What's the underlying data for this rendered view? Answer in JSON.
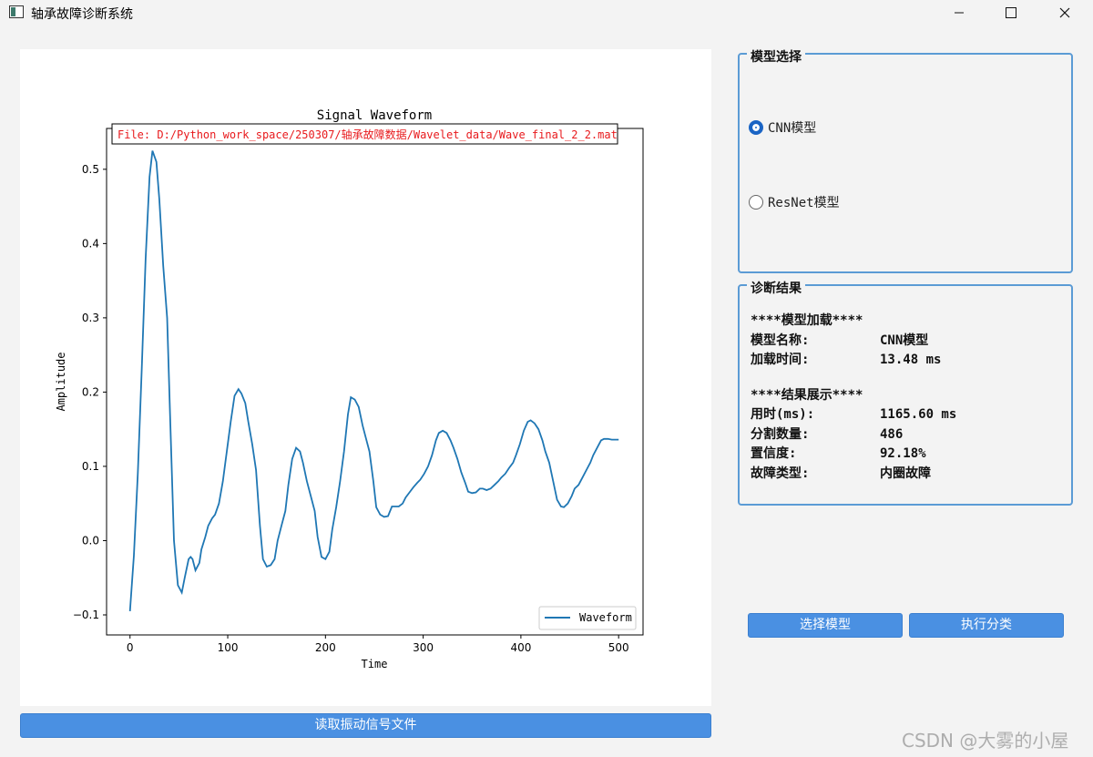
{
  "window": {
    "title": "轴承故障诊断系统",
    "icons": [
      "app-icon",
      "minimize-icon",
      "maximize-icon",
      "close-icon"
    ]
  },
  "plot": {
    "file_label": "File: D:/Python_work_space/250307/轴承故障数据/Wavelet_data/Wave_final_2_2.mat",
    "file_label_color": "#e8191c",
    "line_color": "#1f77b4"
  },
  "chart_data": {
    "type": "line",
    "title": "Signal Waveform",
    "xlabel": "Time",
    "ylabel": "Amplitude",
    "xlim": [
      -24,
      525
    ],
    "ylim": [
      -0.127,
      0.555
    ],
    "xticks": [
      0,
      100,
      200,
      300,
      400,
      500
    ],
    "yticks": [
      -0.1,
      0.0,
      0.1,
      0.2,
      0.3,
      0.4,
      0.5
    ],
    "xtick_labels": [
      "0",
      "100",
      "200",
      "300",
      "400",
      "500"
    ],
    "ytick_labels": [
      "−0.1",
      "0.0",
      "0.1",
      "0.2",
      "0.3",
      "0.4",
      "0.5"
    ],
    "legend": "bottom-right",
    "grid": false,
    "series": [
      {
        "name": "Waveform",
        "x": [
          0,
          4,
          8,
          12,
          16,
          20,
          23,
          27,
          30,
          34,
          38,
          41,
          45,
          49,
          53,
          56,
          60,
          62,
          64,
          67,
          71,
          73,
          77,
          80,
          84,
          87,
          91,
          95,
          99,
          103,
          107,
          111,
          114,
          118,
          121,
          125,
          129,
          133,
          136,
          140,
          144,
          148,
          151,
          155,
          159,
          162,
          166,
          170,
          174,
          177,
          181,
          185,
          189,
          192,
          196,
          200,
          204,
          207,
          211,
          215,
          219,
          223,
          226,
          230,
          234,
          238,
          241,
          245,
          249,
          252,
          256,
          260,
          264,
          268,
          271,
          275,
          279,
          282,
          286,
          290,
          294,
          297,
          301,
          305,
          309,
          313,
          316,
          320,
          324,
          328,
          331,
          335,
          339,
          343,
          346,
          350,
          354,
          358,
          361,
          365,
          369,
          373,
          377,
          380,
          384,
          388,
          392,
          395,
          399,
          403,
          407,
          410,
          414,
          418,
          422,
          425,
          429,
          433,
          437,
          441,
          444,
          448,
          452,
          455,
          459,
          463,
          467,
          471,
          474,
          478,
          482,
          485,
          489,
          493,
          497,
          500
        ],
        "y": [
          -0.095,
          -0.02,
          0.09,
          0.23,
          0.38,
          0.49,
          0.525,
          0.51,
          0.46,
          0.37,
          0.3,
          0.17,
          0.0,
          -0.06,
          -0.07,
          -0.05,
          -0.025,
          -0.022,
          -0.025,
          -0.04,
          -0.03,
          -0.012,
          0.005,
          0.02,
          0.03,
          0.035,
          0.05,
          0.08,
          0.12,
          0.16,
          0.195,
          0.204,
          0.198,
          0.185,
          0.16,
          0.13,
          0.095,
          0.02,
          -0.025,
          -0.035,
          -0.033,
          -0.025,
          0.0,
          0.02,
          0.04,
          0.075,
          0.11,
          0.125,
          0.12,
          0.105,
          0.08,
          0.06,
          0.04,
          0.005,
          -0.022,
          -0.025,
          -0.015,
          0.015,
          0.045,
          0.08,
          0.12,
          0.17,
          0.193,
          0.19,
          0.18,
          0.155,
          0.14,
          0.12,
          0.08,
          0.045,
          0.035,
          0.032,
          0.033,
          0.046,
          0.046,
          0.046,
          0.05,
          0.058,
          0.065,
          0.072,
          0.078,
          0.082,
          0.09,
          0.1,
          0.115,
          0.135,
          0.145,
          0.148,
          0.145,
          0.135,
          0.125,
          0.11,
          0.092,
          0.078,
          0.066,
          0.064,
          0.065,
          0.07,
          0.07,
          0.068,
          0.07,
          0.075,
          0.08,
          0.085,
          0.09,
          0.098,
          0.105,
          0.115,
          0.13,
          0.148,
          0.16,
          0.162,
          0.158,
          0.15,
          0.135,
          0.12,
          0.105,
          0.08,
          0.055,
          0.046,
          0.045,
          0.05,
          0.06,
          0.07,
          0.075,
          0.085,
          0.095,
          0.105,
          0.115,
          0.125,
          0.135,
          0.137,
          0.137,
          0.136,
          0.136,
          0.136
        ]
      }
    ]
  },
  "read_button_label": "读取振动信号文件",
  "model_group": {
    "title": "模型选择",
    "options": [
      {
        "label": "CNN模型",
        "checked": true
      },
      {
        "label": "ResNet模型",
        "checked": false
      }
    ]
  },
  "result_group": {
    "title": "诊断结果",
    "load_header": "****模型加载****",
    "model_name_key": "模型名称:",
    "model_name_val": "CNN模型",
    "load_time_key": "加载时间:",
    "load_time_val": "13.48 ms",
    "result_header": "****结果展示****",
    "time_key": "用时(ms):",
    "time_val": "1165.60 ms",
    "count_key": "分割数量:",
    "count_val": "486",
    "confidence_key": "置信度:",
    "confidence_val": "92.18%",
    "fault_key": "故障类型:",
    "fault_val": "内圈故障"
  },
  "buttons": {
    "select_model": "选择模型",
    "classify": "执行分类"
  },
  "watermark": "CSDN @大雾的小屋"
}
